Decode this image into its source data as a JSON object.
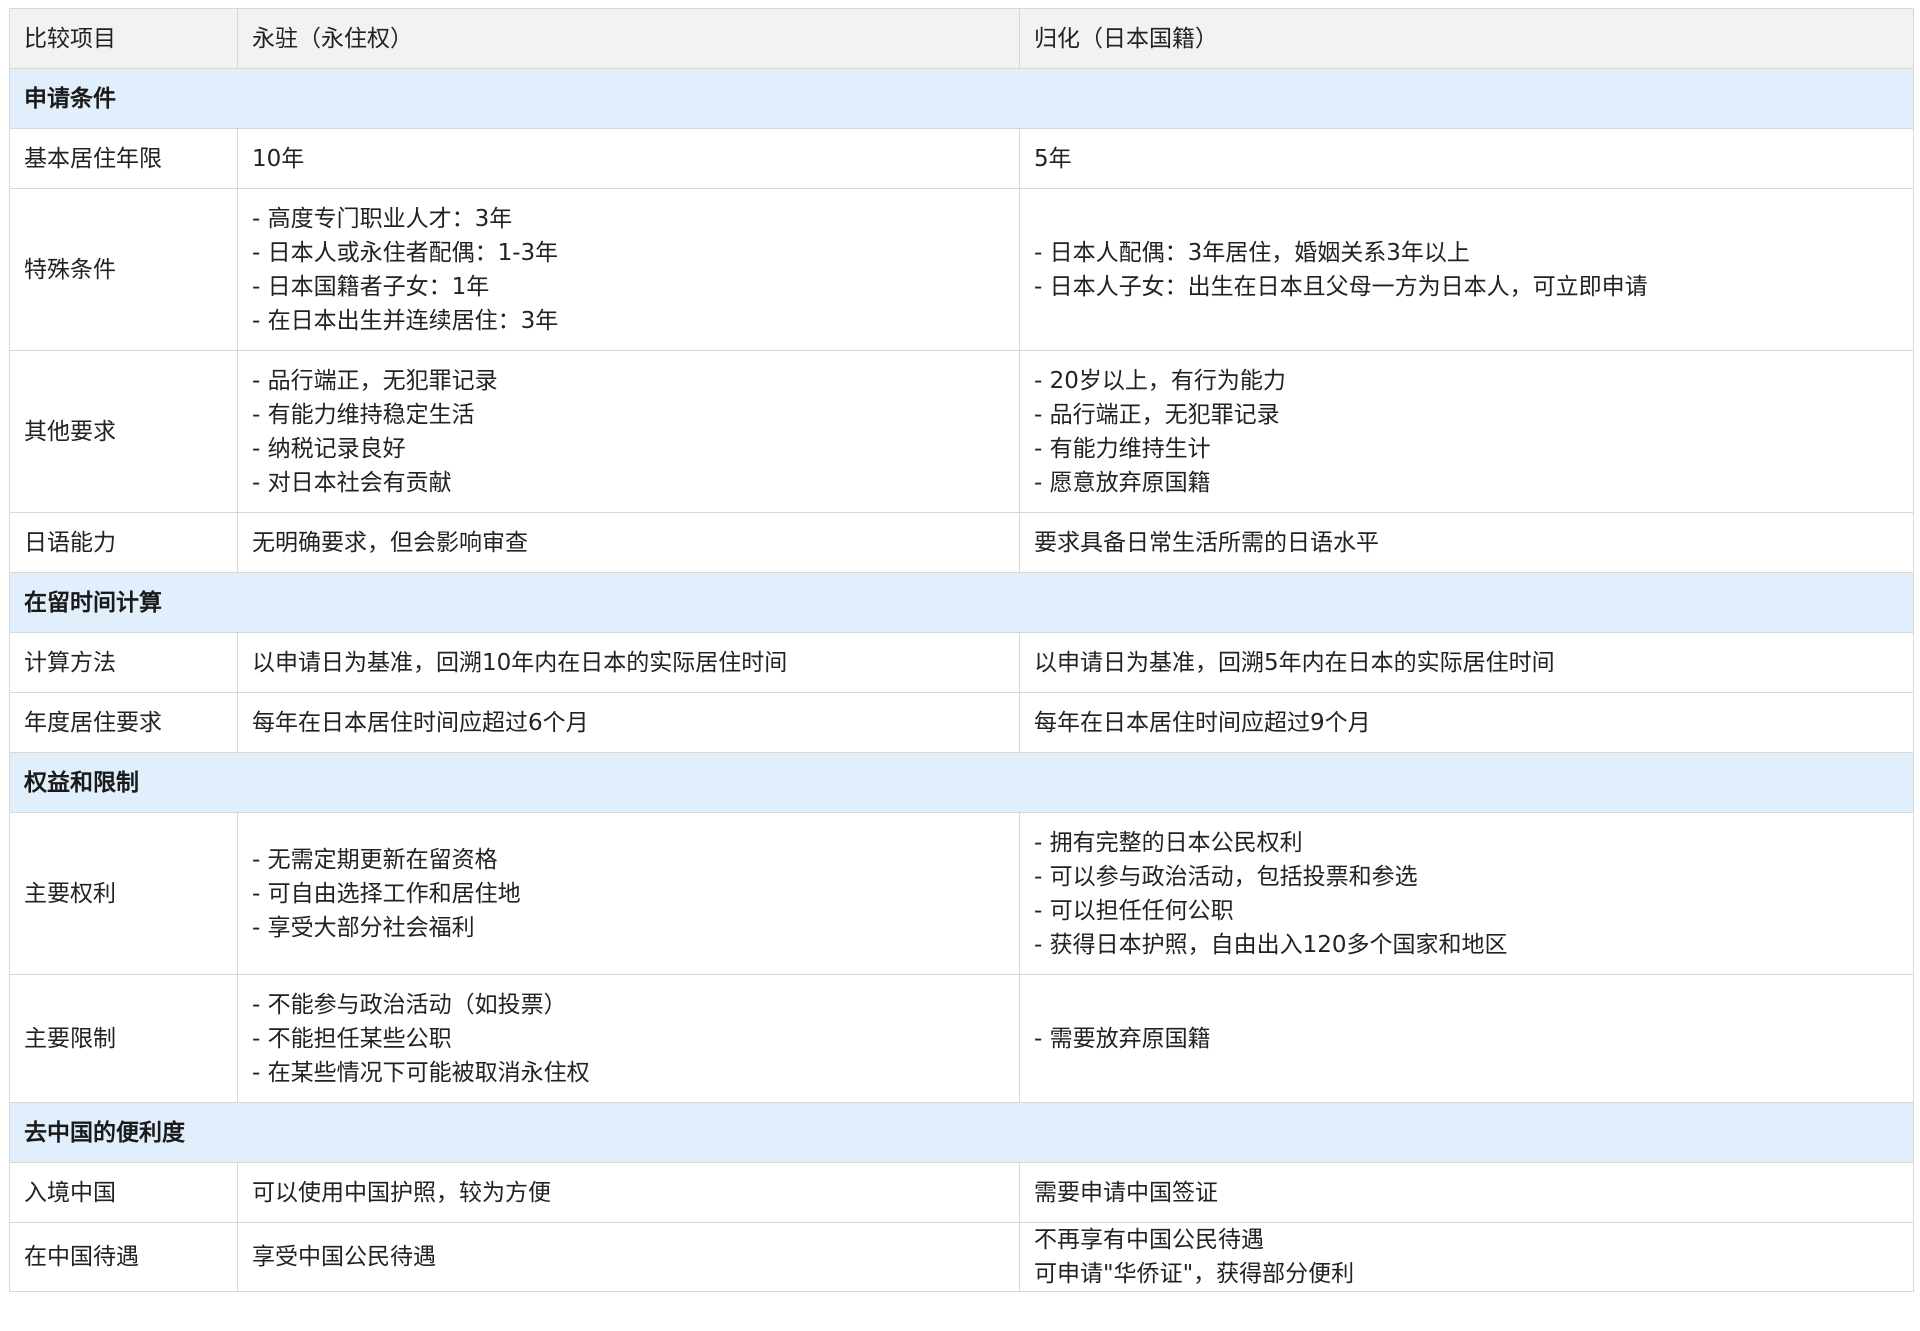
{
  "table": {
    "headers": [
      "比较项目",
      "永驻（永住权）",
      "归化（日本国籍）"
    ],
    "sections": [
      {
        "title": "申请条件",
        "rows": [
          {
            "label": "基本居住年限",
            "col1": [
              "10年"
            ],
            "col2": [
              "5年"
            ]
          },
          {
            "label": "特殊条件",
            "col1": [
              "- 高度专门职业人才：3年",
              "- 日本人或永住者配偶：1-3年",
              "- 日本国籍者子女：1年",
              "- 在日本出生并连续居住：3年"
            ],
            "col2": [
              "- 日本人配偶：3年居住，婚姻关系3年以上",
              "- 日本人子女：出生在日本且父母一方为日本人，可立即申请"
            ]
          },
          {
            "label": "其他要求",
            "col1": [
              "- 品行端正，无犯罪记录",
              "- 有能力维持稳定生活",
              "- 纳税记录良好",
              "- 对日本社会有贡献"
            ],
            "col2": [
              "- 20岁以上，有行为能力",
              "- 品行端正，无犯罪记录",
              "- 有能力维持生计",
              "- 愿意放弃原国籍"
            ]
          },
          {
            "label": "日语能力",
            "col1": [
              "无明确要求，但会影响审查"
            ],
            "col2": [
              "要求具备日常生活所需的日语水平"
            ]
          }
        ]
      },
      {
        "title": "在留时间计算",
        "rows": [
          {
            "label": "计算方法",
            "col1": [
              "以申请日为基准，回溯10年内在日本的实际居住时间"
            ],
            "col2": [
              "以申请日为基准，回溯5年内在日本的实际居住时间"
            ]
          },
          {
            "label": "年度居住要求",
            "col1": [
              "每年在日本居住时间应超过6个月"
            ],
            "col2": [
              "每年在日本居住时间应超过9个月"
            ]
          }
        ]
      },
      {
        "title": "权益和限制",
        "rows": [
          {
            "label": "主要权利",
            "col1": [
              "- 无需定期更新在留资格",
              "- 可自由选择工作和居住地",
              "- 享受大部分社会福利"
            ],
            "col2": [
              "- 拥有完整的日本公民权利",
              "- 可以参与政治活动，包括投票和参选",
              "- 可以担任任何公职",
              "- 获得日本护照，自由出入120多个国家和地区"
            ]
          },
          {
            "label": "主要限制",
            "col1": [
              "- 不能参与政治活动（如投票）",
              "- 不能担任某些公职",
              "- 在某些情况下可能被取消永住权"
            ],
            "col2": [
              "- 需要放弃原国籍"
            ]
          }
        ]
      },
      {
        "title": "去中国的便利度",
        "rows": [
          {
            "label": "入境中国",
            "col1": [
              "可以使用中国护照，较为方便"
            ],
            "col2": [
              "需要申请中国签证"
            ]
          },
          {
            "label": "在中国待遇",
            "col1": [
              "享受中国公民待遇"
            ],
            "col2": [
              "不再享有中国公民待遇",
              "可申请\"华侨证\"，获得部分便利"
            ]
          }
        ]
      }
    ]
  }
}
